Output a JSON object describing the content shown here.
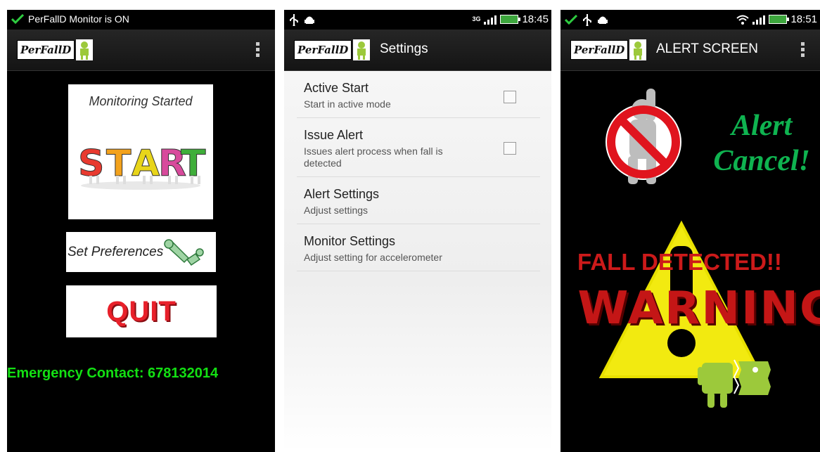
{
  "screen1": {
    "status_text": "PerFallD Monitor is ON",
    "logo_text": "PerFallD",
    "start_card_caption": "Monitoring Started",
    "start_word": "START",
    "preferences_label": "Set Preferences",
    "quit_label": "QUIT",
    "emergency_text": "Emergency Contact: 678132014"
  },
  "screen2": {
    "network_label": "3G",
    "time": "18:45",
    "logo_text": "PerFallD",
    "title": "Settings",
    "items": [
      {
        "title": "Active Start",
        "subtitle": "Start in active mode",
        "has_checkbox": true,
        "checked": false
      },
      {
        "title": "Issue Alert",
        "subtitle": "Issues alert process when fall is detected",
        "has_checkbox": true,
        "checked": false
      },
      {
        "title": "Alert Settings",
        "subtitle": "Adjust settings",
        "has_checkbox": false
      },
      {
        "title": "Monitor Settings",
        "subtitle": "Adjust setting for accelerometer",
        "has_checkbox": false
      }
    ]
  },
  "screen3": {
    "time": "18:51",
    "logo_text": "PerFallD",
    "title": "ALERT SCREEN",
    "cancel_line1": "Alert",
    "cancel_line2": "Cancel!",
    "fall_detected": "FALL DETECTED!!",
    "warning": "WARNING"
  },
  "colors": {
    "emergency_green": "#13e013",
    "cancel_green": "#0fb350",
    "warning_red": "#c41616",
    "triangle_yellow": "#f2ea10"
  }
}
